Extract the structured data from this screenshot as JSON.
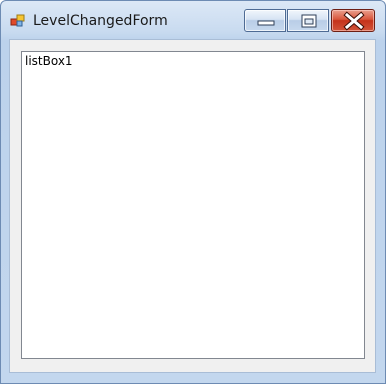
{
  "window": {
    "title": "LevelChangedForm",
    "controls": {
      "minimize": "minimize-icon",
      "maximize": "maximize-icon",
      "close": "close-icon"
    },
    "app_icon": "form-app-icon"
  },
  "listbox": {
    "items": [
      "listBox1"
    ]
  },
  "colors": {
    "close_button": "#c4321a",
    "frame": "#c3d7ee",
    "client_background": "#f0f0f0",
    "listbox_border": "#828790"
  }
}
